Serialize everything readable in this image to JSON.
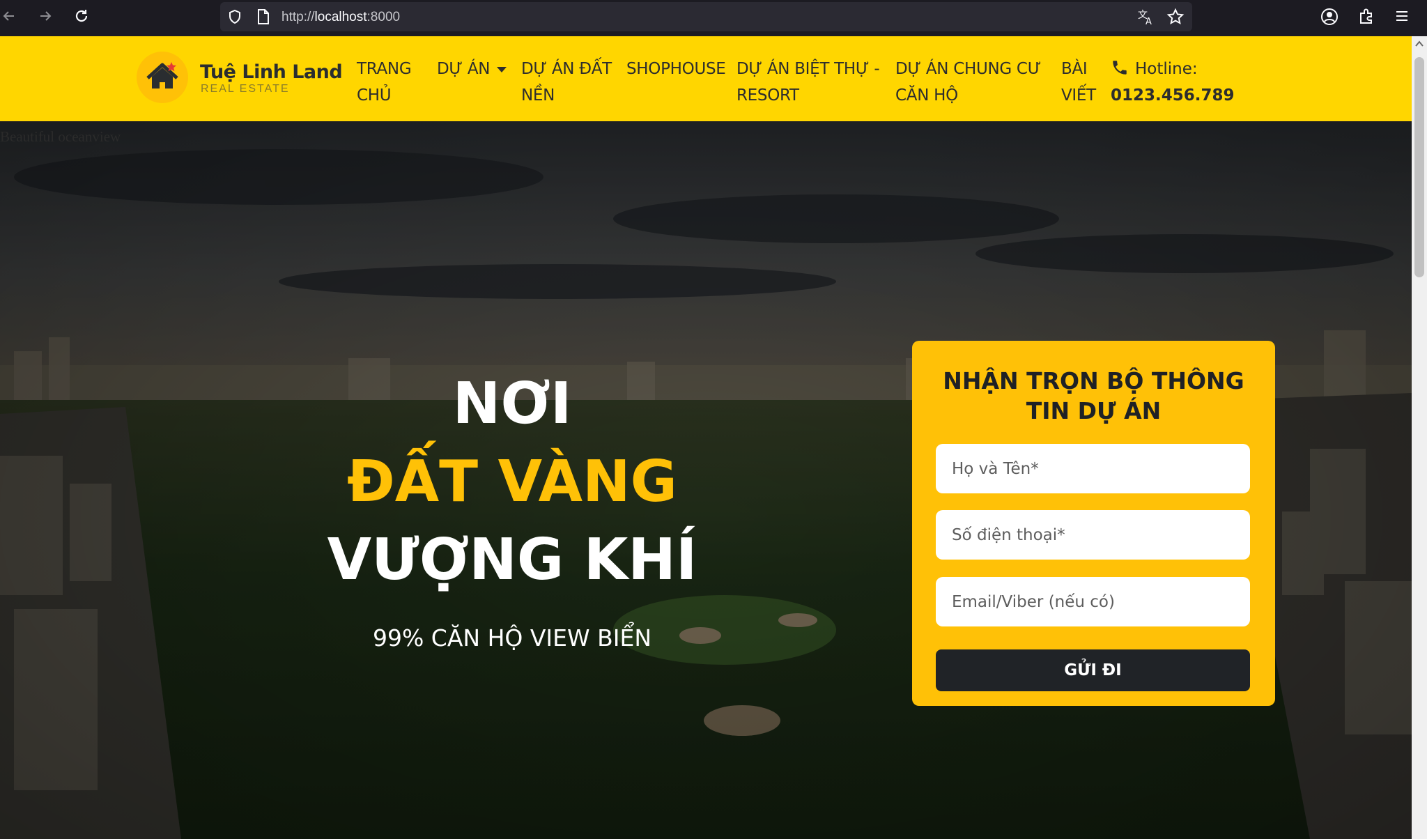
{
  "browser": {
    "url_scheme": "http://",
    "url_host": "localhost",
    "url_port": ":8000"
  },
  "header": {
    "brand_name": "Tuệ Linh Land",
    "brand_tagline": "REAL ESTATE",
    "nav": [
      {
        "line1": "TRANG",
        "line2": "CHỦ"
      },
      {
        "line1": "DỰ ÁN",
        "line2": ""
      },
      {
        "line1": "DỰ ÁN ĐẤT",
        "line2": "NỀN"
      },
      {
        "line1": "SHOPHOUSE",
        "line2": ""
      },
      {
        "line1": "DỰ ÁN BIỆT THỰ -",
        "line2": "RESORT"
      },
      {
        "line1": "DỰ ÁN CHUNG CƯ",
        "line2": "CĂN HỘ"
      },
      {
        "line1": "BÀI",
        "line2": "VIẾT"
      }
    ],
    "hotline_label": "Hotline:",
    "hotline_number": "0123.456.789"
  },
  "hero": {
    "image_alt": "Beautiful oceanview",
    "title_line1": "NƠI",
    "title_line2": "ĐẤT VÀNG",
    "title_line3": "VƯỢNG KHÍ",
    "subtitle": "99% CĂN HỘ VIEW BIỂN"
  },
  "form": {
    "title_line1": "NHẬN TRỌN BỘ THÔNG",
    "title_line2": "TIN DỰ ÁN",
    "name_placeholder": "Họ và Tên*",
    "phone_placeholder": "Số điện thoại*",
    "email_placeholder": "Email/Viber (nếu có)",
    "submit_label": "GỬI ĐI"
  },
  "colors": {
    "header_bg": "#ffd600",
    "accent": "#ffc107",
    "dark": "#202327"
  }
}
